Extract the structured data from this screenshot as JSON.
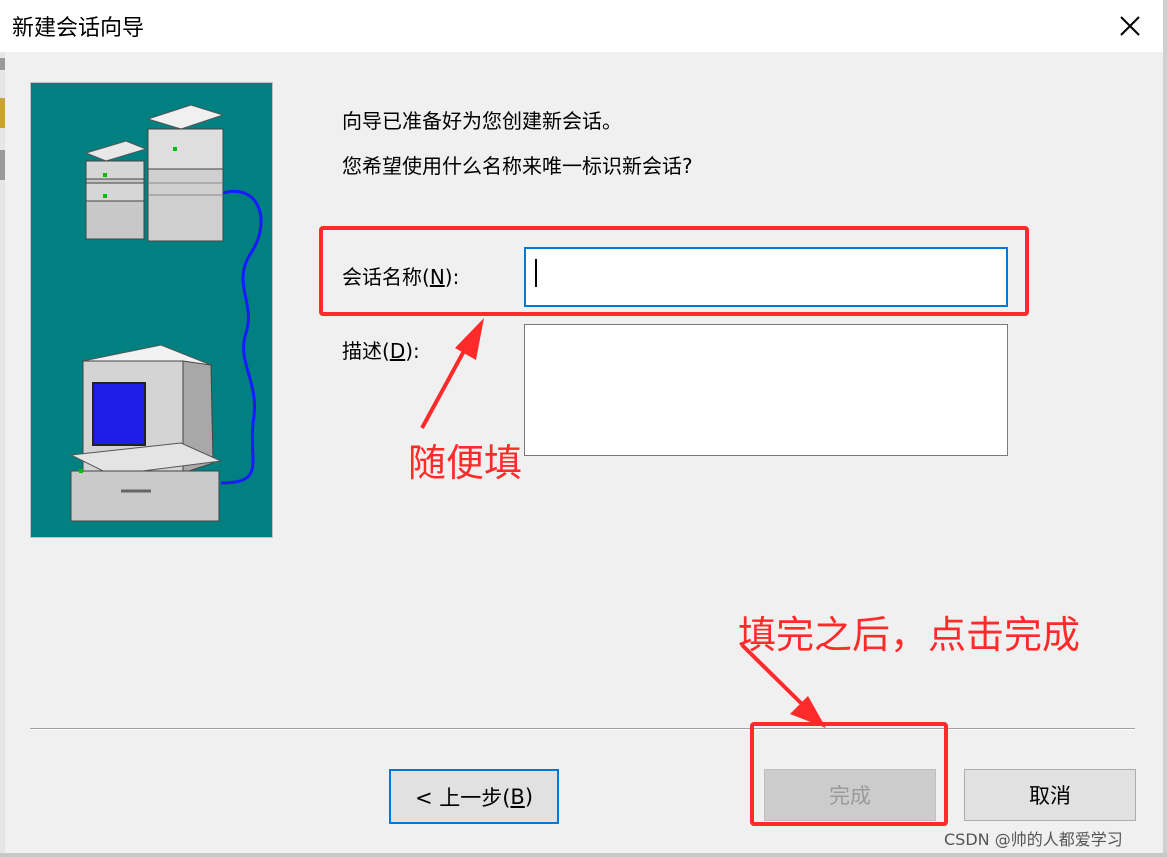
{
  "window": {
    "title": "新建会话向导",
    "close_icon": "close-icon"
  },
  "wizard": {
    "intro_line1": "向导已准备好为您创建新会话。",
    "intro_line2": "您希望使用什么名称来唯一标识新会话?",
    "name_label": "会话名称(",
    "name_mnemonic": "N",
    "name_label_end": "):",
    "name_value": "",
    "desc_label": "描述(",
    "desc_mnemonic": "D",
    "desc_label_end": "):",
    "desc_value": ""
  },
  "buttons": {
    "back_prefix": "< 上一步(",
    "back_mnemonic": "B",
    "back_suffix": ")",
    "finish": "完成",
    "cancel": "取消"
  },
  "annotations": {
    "fill_anything": "随便填",
    "click_finish": "填完之后，点击完成",
    "color": "#ff2a2a"
  },
  "watermark": "CSDN @帅的人都爱学习"
}
